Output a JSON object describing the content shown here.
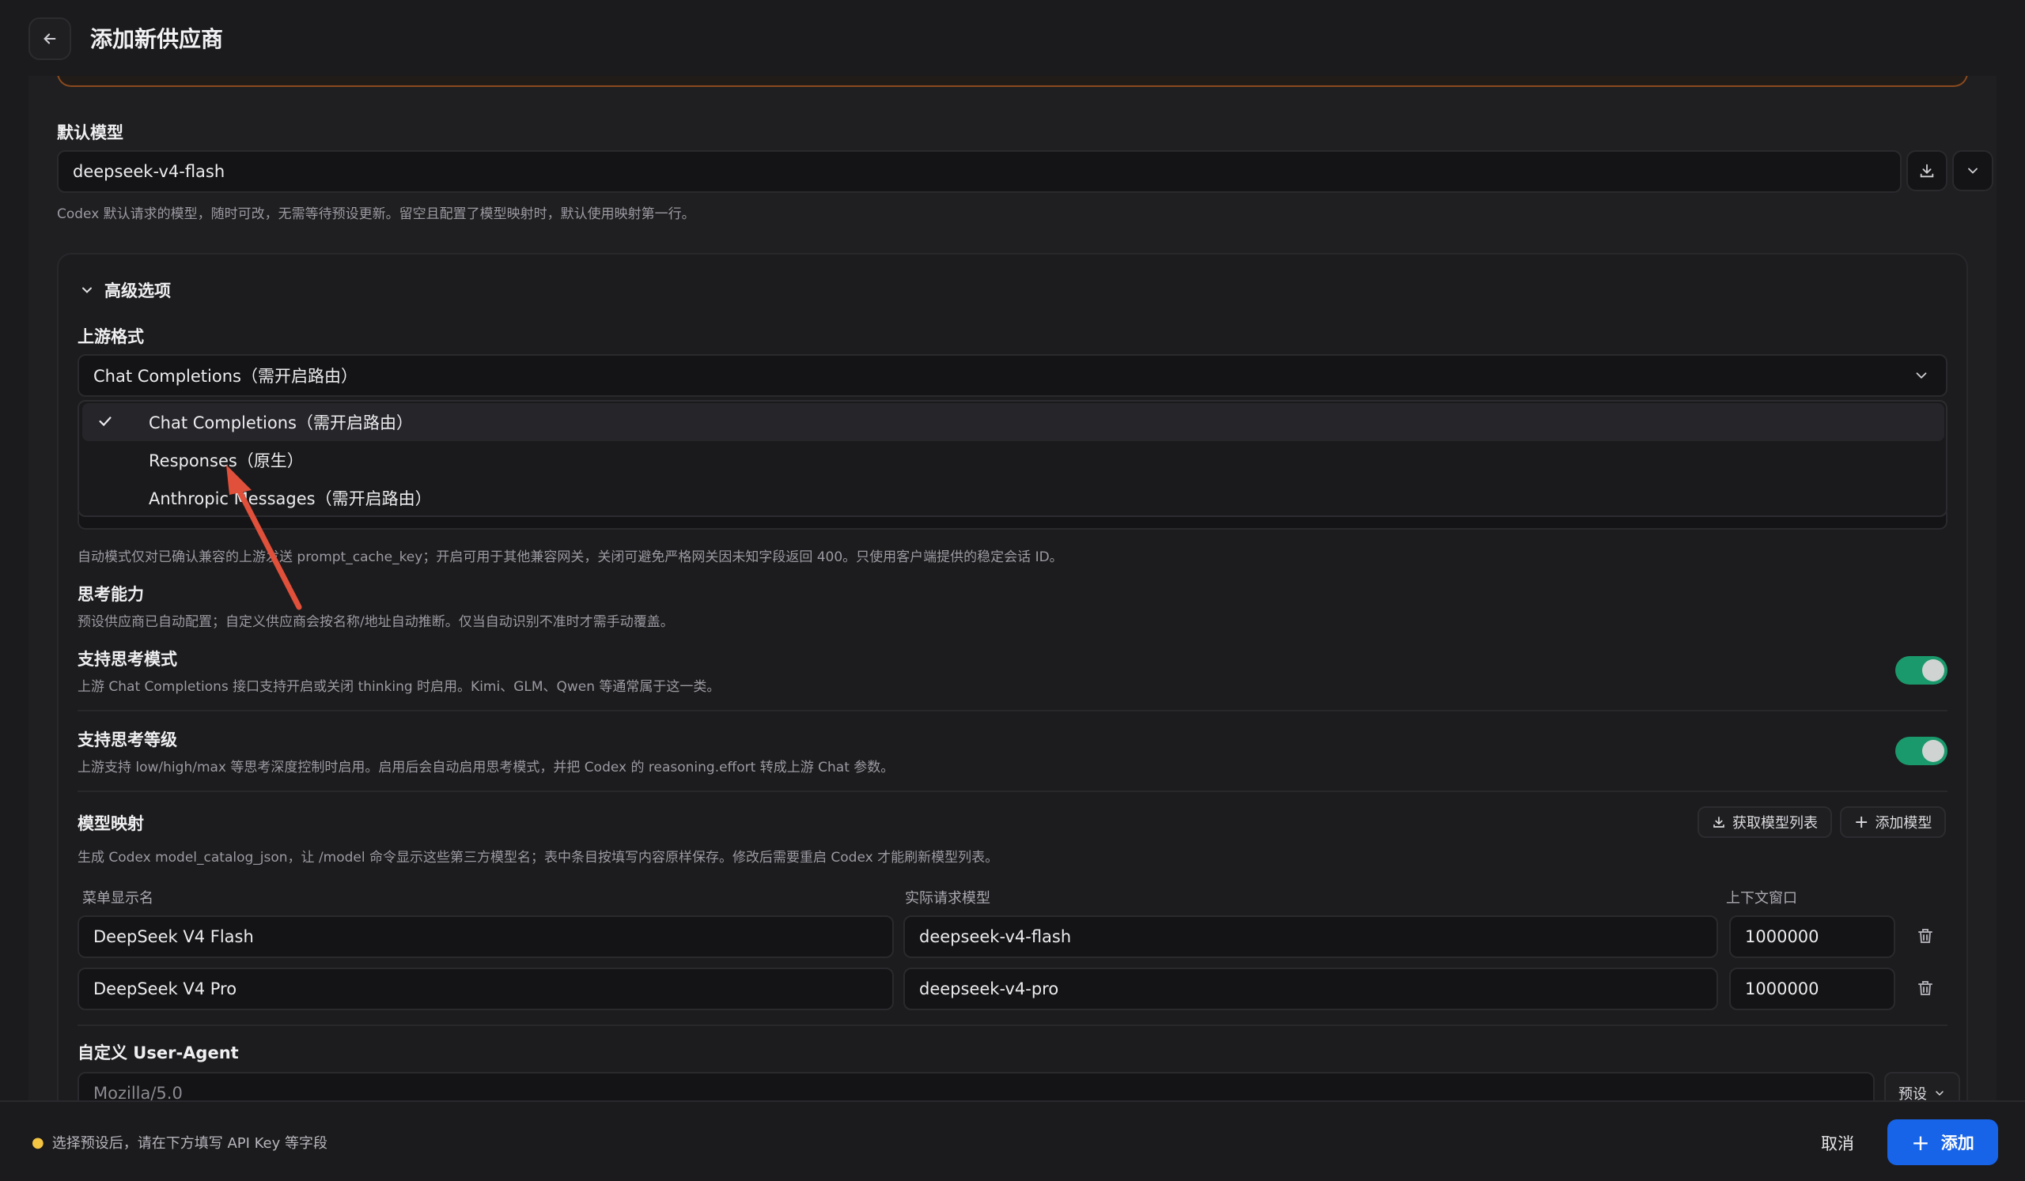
{
  "header": {
    "title": "添加新供应商"
  },
  "default_model": {
    "label": "默认模型",
    "value": "deepseek-v4-flash",
    "hint": "Codex 默认请求的模型，随时可改，无需等待预设更新。留空且配置了模型映射时，默认使用映射第一行。"
  },
  "advanced": {
    "title": "高级选项",
    "upstream_format": {
      "label": "上游格式",
      "selected": "Chat Completions（需开启路由）",
      "options": [
        "Chat Completions（需开启路由）",
        "Responses（原生）",
        "Anthropic Messages（需开启路由）"
      ]
    },
    "cache_hint": "自动模式仅对已确认兼容的上游发送 prompt_cache_key；开启可用于其他兼容网关，关闭可避免严格网关因未知字段返回 400。只使用客户端提供的稳定会话 ID。",
    "thinking": {
      "label": "思考能力",
      "hint": "预设供应商已自动配置；自定义供应商会按名称/地址自动推断。仅当自动识别不准时才需手动覆盖。"
    },
    "thinking_mode": {
      "label": "支持思考模式",
      "hint": "上游 Chat Completions 接口支持开启或关闭 thinking 时启用。Kimi、GLM、Qwen 等通常属于这一类。",
      "enabled": true
    },
    "thinking_level": {
      "label": "支持思考等级",
      "hint": "上游支持 low/high/max 等思考深度控制时启用。启用后会自动启用思考模式，并把 Codex 的 reasoning.effort 转成上游 Chat 参数。",
      "enabled": true
    },
    "model_mapping": {
      "label": "模型映射",
      "hint": "生成 Codex model_catalog_json，让 /model 命令显示这些第三方模型名；表中条目按填写内容原样保存。修改后需要重启 Codex 才能刷新模型列表。",
      "fetch_button": "获取模型列表",
      "add_button": "添加模型",
      "columns": [
        "菜单显示名",
        "实际请求模型",
        "上下文窗口"
      ],
      "rows": [
        {
          "display": "DeepSeek V4 Flash",
          "model": "deepseek-v4-flash",
          "context": "1000000"
        },
        {
          "display": "DeepSeek V4 Pro",
          "model": "deepseek-v4-pro",
          "context": "1000000"
        }
      ]
    },
    "user_agent": {
      "label": "自定义 User-Agent",
      "value": "Mozilla/5.0",
      "preset_button": "预设"
    }
  },
  "footer": {
    "hint": "选择预设后，请在下方填写 API Key 等字段",
    "cancel": "取消",
    "add": "添加"
  },
  "colors": {
    "accent": "#1764e8",
    "toggle_on": "#1a9a6c",
    "annotation_arrow": "#e0503a"
  }
}
